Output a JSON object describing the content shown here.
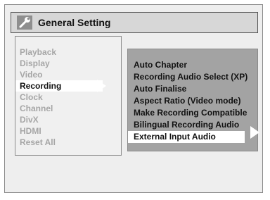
{
  "title": "General Setting",
  "title_icon": "wrench-icon",
  "main_menu": {
    "items": [
      {
        "label": "Playback"
      },
      {
        "label": "Display"
      },
      {
        "label": "Video"
      },
      {
        "label": "Recording"
      },
      {
        "label": "Clock"
      },
      {
        "label": "Channel"
      },
      {
        "label": "DivX"
      },
      {
        "label": "HDMI"
      },
      {
        "label": "Reset All"
      }
    ],
    "selected_label": "Recording"
  },
  "sub_menu": {
    "items": [
      {
        "label": "Auto Chapter"
      },
      {
        "label": "Recording Audio Select (XP)"
      },
      {
        "label": "Auto Finalise"
      },
      {
        "label": "Aspect Ratio (Video mode)"
      },
      {
        "label": "Make Recording Compatible"
      },
      {
        "label": "Bilingual Recording Audio"
      },
      {
        "label": "External Input Audio"
      }
    ],
    "selected_label": "External Input Audio"
  },
  "colors": {
    "background": "#eeeeee",
    "title_bar": "#d7d7d7",
    "sub_menu_bg": "#a3a3a3",
    "highlight": "#ffffff",
    "dim_text": "#a6a6a6",
    "text": "#111111"
  }
}
